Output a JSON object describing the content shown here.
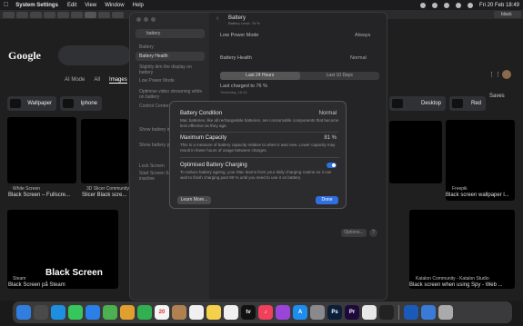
{
  "menubar": {
    "app": "System Settings",
    "menus": [
      "Edit",
      "View",
      "Window",
      "Help"
    ],
    "clock": "Fri 20 Feb  18:49"
  },
  "browser": {
    "logo": "Google",
    "nav": [
      "AI Mode",
      "All",
      "Images"
    ],
    "chips": [
      "Wallpaper",
      "Iphone",
      "Desktop",
      "Red"
    ],
    "saves": "Saves",
    "tab_right": "black scre",
    "results": [
      {
        "source": "White Screen",
        "title": "Black Screen – Fullscre..."
      },
      {
        "source": "3D Slicer Community",
        "title": "Slicer Black scre..."
      },
      {
        "source": "Freepik",
        "title": "Black screen wallpaper l..."
      },
      {
        "source": "Steam",
        "title": "Black Screen på Steam",
        "overlay": "Black Screen"
      },
      {
        "source": "Katalon Community - Katalon Studio",
        "title": "Black screen when using Spy - Web ..."
      }
    ]
  },
  "settings": {
    "search_value": "battery",
    "sidebar": {
      "section": "Battery",
      "items": [
        "Battery Health",
        "Slightly dim the display on battery",
        "Low Power Mode",
        "Optimise video streaming while on battery",
        "Control Centre",
        "Show battery in menu bar",
        "Show battery percentage",
        "Lock Screen",
        "Start Screen Saver when inactive"
      ]
    },
    "header": {
      "title": "Battery",
      "subtitle": "Battery Level: 76 %"
    },
    "low_power": {
      "label": "Low Power Mode",
      "value": "Always"
    },
    "health": {
      "label": "Battery Health",
      "value": "Normal"
    },
    "segments": [
      "Last 24 Hours",
      "Last 10 Days"
    ],
    "last_charged": "Last charged to 76 %",
    "last_charged_time": "Yesterday, 15:34",
    "options": "Options...",
    "help": "?"
  },
  "modal": {
    "condition": {
      "title": "Battery Condition",
      "value": "Normal",
      "desc": "Mac batteries, like all rechargeable batteries, are consumable components that become less effective as they age."
    },
    "capacity": {
      "title": "Maximum Capacity",
      "value": "81 %",
      "desc": "This is a measure of battery capacity relative to when it was new. Lower capacity may result in fewer hours of usage between charges."
    },
    "charging": {
      "title": "Optimised Battery Charging",
      "enabled": true,
      "desc": "To reduce battery ageing, your Mac learns from your daily charging routine so it can wait to finish charging past 80 % until you need to use it on battery."
    },
    "learn_more": "Learn More...",
    "done": "Done"
  },
  "dock": {
    "calendar_day": "20",
    "items": [
      {
        "icon": "finder-icon",
        "color": "#2f7ee0",
        "glyph": ""
      },
      {
        "icon": "launchpad-icon",
        "color": "#4a4a4a",
        "glyph": ""
      },
      {
        "icon": "safari-icon",
        "color": "#1e8fe0",
        "glyph": ""
      },
      {
        "icon": "messages-icon",
        "color": "#35c759",
        "glyph": ""
      },
      {
        "icon": "mail-icon",
        "color": "#2a7fe8",
        "glyph": ""
      },
      {
        "icon": "maps-icon",
        "color": "#4caf50",
        "glyph": ""
      },
      {
        "icon": "photos-icon",
        "color": "#e0a030",
        "glyph": ""
      },
      {
        "icon": "facetime-icon",
        "color": "#30b050",
        "glyph": ""
      },
      {
        "icon": "calendar-icon",
        "color": "#f4f4f4",
        "glyph": "20"
      },
      {
        "icon": "contacts-icon",
        "color": "#b08050",
        "glyph": ""
      },
      {
        "icon": "reminders-icon",
        "color": "#f0f0f0",
        "glyph": ""
      },
      {
        "icon": "notes-icon",
        "color": "#f5d04a",
        "glyph": ""
      },
      {
        "icon": "freeform-icon",
        "color": "#f0f0f0",
        "glyph": ""
      },
      {
        "icon": "tv-icon",
        "color": "#111111",
        "glyph": "tv"
      },
      {
        "icon": "music-icon",
        "color": "#f0405a",
        "glyph": "♪"
      },
      {
        "icon": "podcasts-icon",
        "color": "#9a45d8",
        "glyph": ""
      },
      {
        "icon": "app-store-icon",
        "color": "#1d8ef0",
        "glyph": "A"
      },
      {
        "icon": "system-settings-icon",
        "color": "#8a8a8e",
        "glyph": ""
      },
      {
        "icon": "photoshop-icon",
        "color": "#0a1e3a",
        "glyph": "Ps"
      },
      {
        "icon": "premiere-icon",
        "color": "#1e0a3a",
        "glyph": "Pr"
      },
      {
        "icon": "chrome-icon",
        "color": "#e8e8e8",
        "glyph": ""
      },
      {
        "icon": "terminal-icon",
        "color": "#222222",
        "glyph": ""
      },
      {
        "icon": "word-icon",
        "color": "#1a5ab8",
        "glyph": ""
      },
      {
        "icon": "files-icon",
        "color": "#3a7ad8",
        "glyph": ""
      },
      {
        "icon": "trash-icon",
        "color": "#aaaaaa",
        "glyph": ""
      }
    ]
  }
}
